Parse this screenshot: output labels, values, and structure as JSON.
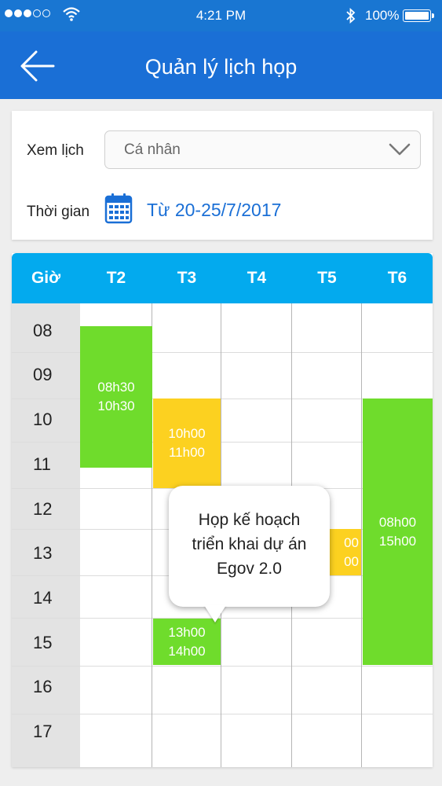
{
  "status_bar": {
    "time": "4:21 PM",
    "battery": "100%",
    "signal_bars": 3,
    "icons": [
      "signal-icon",
      "wifi-icon",
      "bluetooth-icon",
      "battery-icon"
    ]
  },
  "app_bar": {
    "title": "Quản lý lịch họp",
    "back_icon": "arrow-left-icon"
  },
  "filter": {
    "view_label": "Xem lịch",
    "view_value": "Cá nhân",
    "time_label": "Thời gian",
    "time_range": "Từ 20-25/7/2017"
  },
  "schedule": {
    "hour_header": "Giờ",
    "days": [
      "T2",
      "T3",
      "T4",
      "T5",
      "T6"
    ],
    "hours": [
      "08",
      "09",
      "10",
      "11",
      "12",
      "13",
      "14",
      "15",
      "16",
      "17"
    ],
    "events": [
      {
        "day": "T2",
        "start": "08h30",
        "end": "10h30",
        "color": "#6fdc2c"
      },
      {
        "day": "T3",
        "start": "10h00",
        "end": "11h00",
        "color": "#fcd120"
      },
      {
        "day": "T3",
        "start": "13h00",
        "end": "14h00",
        "color": "#6fdc2c"
      },
      {
        "day": "T5",
        "start": "00",
        "end": "00",
        "color": "#fcd120"
      },
      {
        "day": "T6",
        "start": "08h00",
        "end": "15h00",
        "color": "#6fdc2c"
      }
    ],
    "tooltip": {
      "line1": "Họp kế hoạch",
      "line2": "triển khai dự án",
      "line3": "Egov 2.0"
    }
  },
  "colors": {
    "app_bar": "#1a6fd6",
    "header": "#03aaee",
    "event_green": "#6fdc2c",
    "event_yellow": "#fcd120",
    "link": "#1a6fd6"
  }
}
